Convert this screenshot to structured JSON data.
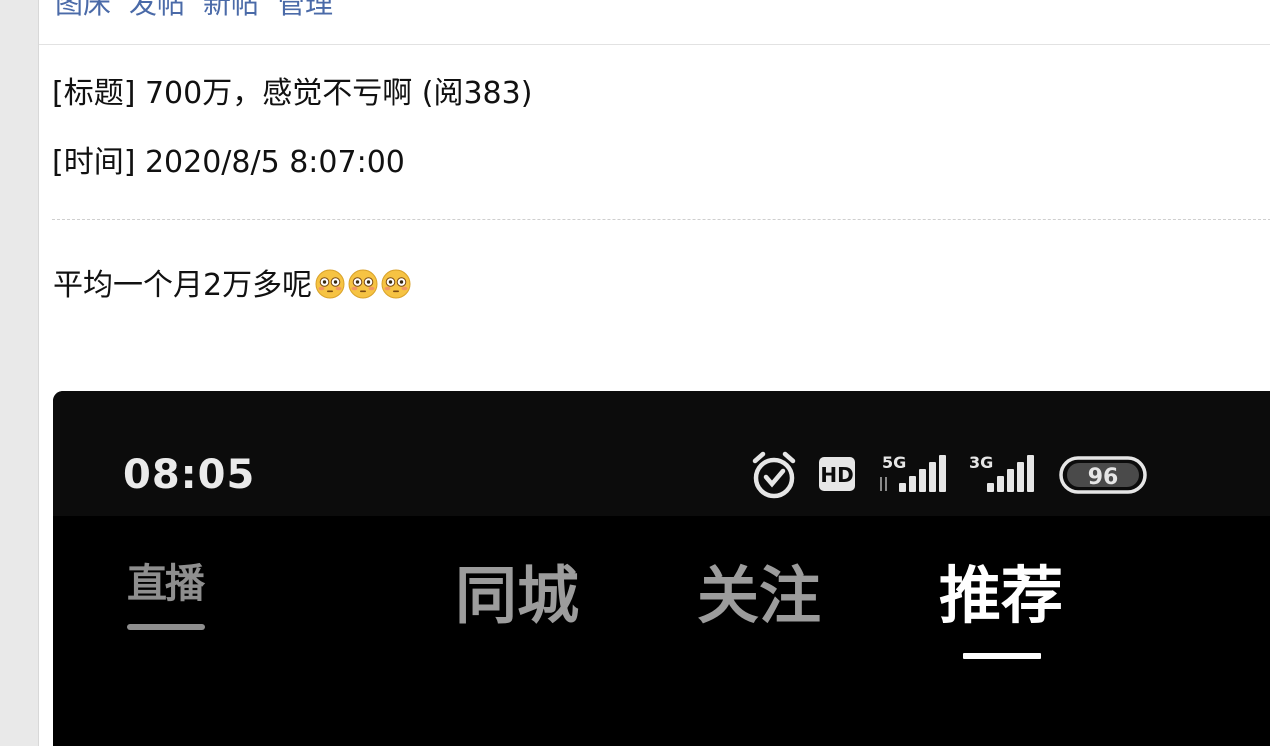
{
  "nav": {
    "links": [
      "图床",
      "发帖",
      "新帖",
      "管理"
    ]
  },
  "post": {
    "title_line": "[标题] 700万，感觉不亏啊 (阅383)",
    "time_line": "[时间] 2020/8/5 8:07:00",
    "body_text": "平均一个月2万多呢",
    "body_emoji": [
      "flushed-face-icon",
      "flushed-face-icon",
      "flushed-face-icon"
    ]
  },
  "screenshot": {
    "status_bar": {
      "time": "08:05",
      "hd_label": "HD",
      "network_1": "5G",
      "network_2": "3G",
      "battery": "96"
    },
    "tabs": {
      "live": "直播",
      "city": "同城",
      "follow": "关注",
      "recommend": "推荐",
      "active": "推荐"
    }
  },
  "colors": {
    "link": "#4a6aa8",
    "text": "#111111",
    "screenshot_bg": "#000000",
    "tab_inactive": "#9c9c9c",
    "tab_active": "#ffffff"
  }
}
